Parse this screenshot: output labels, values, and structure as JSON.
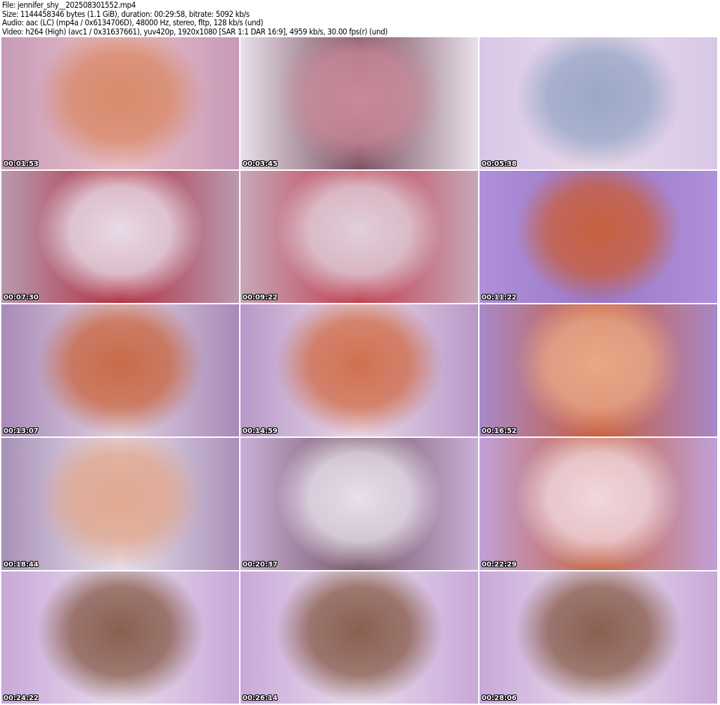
{
  "header": {
    "file": "File: jennifer_shy__202508301552.mp4",
    "size": "Size: 1144458346 bytes (1.1 GiB), duration: 00:29:58, bitrate: 5092 kb/s",
    "audio": "Audio: aac (LC) (mp4a / 0x6134706D), 48000 Hz, stereo, fltp, 128 kb/s (und)",
    "video": "Video: h264 (High) (avc1 / 0x31637661), yuv420p, 1920x1080 [SAR 1:1 DAR 16:9], 4959 kb/s, 30.00 fps(r) (und)"
  },
  "thumbnails": [
    {
      "time": "00:01:53",
      "colors": [
        "#c89ab8",
        "#d98a6a",
        "#e8c0c8"
      ]
    },
    {
      "time": "00:03:45",
      "colors": [
        "#e8e0ea",
        "#c98a9a",
        "#7a5060"
      ]
    },
    {
      "time": "00:05:38",
      "colors": [
        "#d8c8e8",
        "#9aa8c8",
        "#e8d8e8"
      ]
    },
    {
      "time": "00:07:30",
      "colors": [
        "#b89ab0",
        "#e8dce8",
        "#b03040"
      ]
    },
    {
      "time": "00:09:22",
      "colors": [
        "#c8a8b8",
        "#e0d0dc",
        "#c04050"
      ]
    },
    {
      "time": "00:11:22",
      "colors": [
        "#b090d8",
        "#c86040",
        "#9a78c8"
      ]
    },
    {
      "time": "00:13:07",
      "colors": [
        "#a88ab8",
        "#c86a48",
        "#e0d0e0"
      ]
    },
    {
      "time": "00:14:59",
      "colors": [
        "#b898c8",
        "#d07050",
        "#e8d8e8"
      ]
    },
    {
      "time": "00:16:52",
      "colors": [
        "#a888c8",
        "#e8a888",
        "#c86040"
      ]
    },
    {
      "time": "00:18:44",
      "colors": [
        "#a890b8",
        "#e0a890",
        "#e8e0ea"
      ]
    },
    {
      "time": "00:20:37",
      "colors": [
        "#c8b0d8",
        "#e8e0ec",
        "#7a5a6a"
      ]
    },
    {
      "time": "00:22:29",
      "colors": [
        "#c0a0d8",
        "#f0d8e0",
        "#c86848"
      ]
    },
    {
      "time": "00:24:22",
      "colors": [
        "#c8a8d8",
        "#8a6050",
        "#e8dcec"
      ]
    },
    {
      "time": "00:26:14",
      "colors": [
        "#c8a8d8",
        "#8a6050",
        "#e8dcec"
      ]
    },
    {
      "time": "00:28:06",
      "colors": [
        "#c8a8d8",
        "#8a6050",
        "#e8dcec"
      ]
    }
  ]
}
